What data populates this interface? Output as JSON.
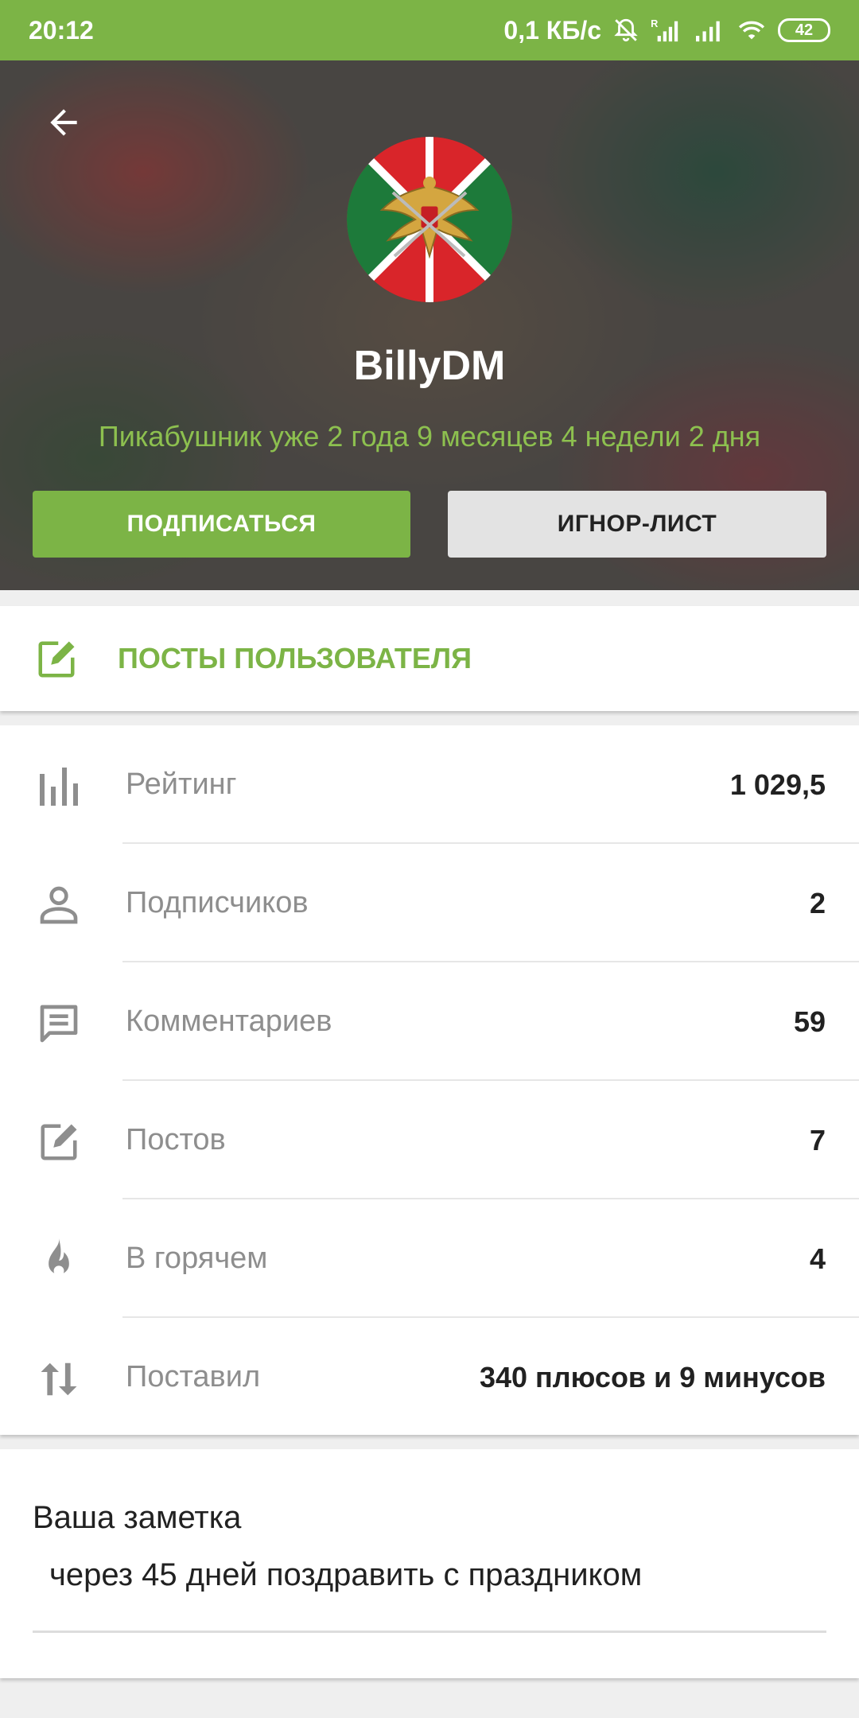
{
  "status_bar": {
    "time": "20:12",
    "network_speed": "0,1 КБ/с",
    "battery": "42"
  },
  "profile": {
    "username": "BillyDM",
    "tenure": "Пикабушник уже 2 года 9 месяцев 4 недели 2 дня",
    "subscribe_label": "ПОДПИСАТЬСЯ",
    "ignore_label": "ИГНОР-ЛИСТ"
  },
  "posts_link": {
    "label": "ПОСТЫ ПОЛЬЗОВАТЕЛЯ",
    "icon": "edit-square-icon"
  },
  "stats": [
    {
      "label": "Рейтинг",
      "value": "1 029,5",
      "icon": "bar-chart-icon"
    },
    {
      "label": "Подписчиков",
      "value": "2",
      "icon": "person-icon"
    },
    {
      "label": "Комментариев",
      "value": "59",
      "icon": "comment-icon"
    },
    {
      "label": "Постов",
      "value": "7",
      "icon": "edit-square-icon"
    },
    {
      "label": "В горячем",
      "value": "4",
      "icon": "flame-icon"
    },
    {
      "label": "Поставил",
      "value": "340 плюсов и 9 минусов",
      "icon": "sort-arrows-icon"
    }
  ],
  "note": {
    "title": "Ваша заметка",
    "text": "через 45 дней поздравить с праздником"
  },
  "colors": {
    "accent": "#7cb446",
    "label_gray": "#8e8e8e",
    "text_dark": "#212121",
    "ignore_bg": "#e3e3e3"
  }
}
